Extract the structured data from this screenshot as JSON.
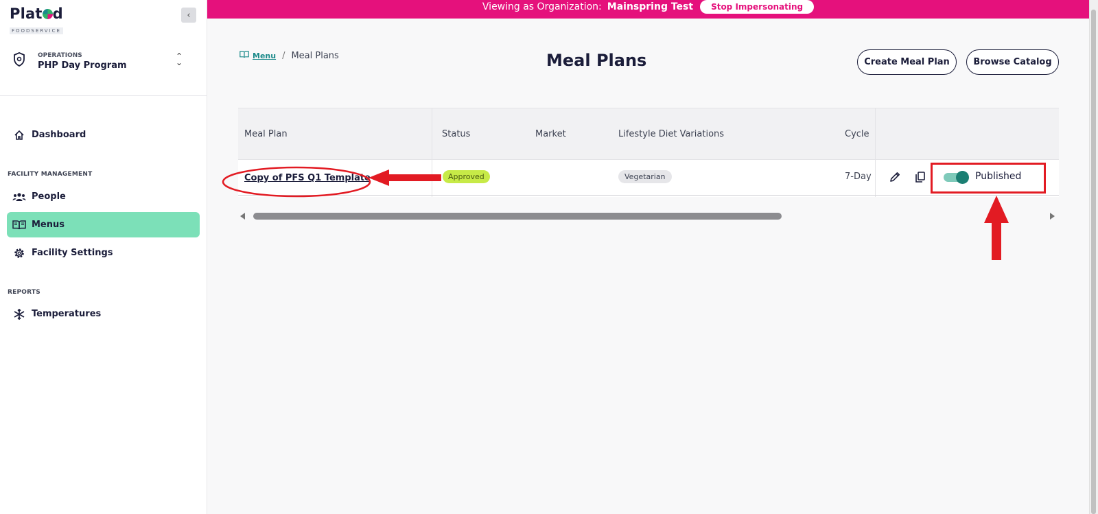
{
  "banner": {
    "viewing_text": "Viewing as Organization:",
    "organization": "Mainspring Test",
    "stop_button": "Stop Impersonating"
  },
  "logo": {
    "word_start": "Plat",
    "word_end": "d",
    "sub": "FOODSERVICE"
  },
  "org_switcher": {
    "label": "OPERATIONS",
    "name": "PHP Day Program"
  },
  "sidebar": {
    "dashboard": "Dashboard",
    "facility_section": "FACILITY MANAGEMENT",
    "people": "People",
    "menus": "Menus",
    "facility_settings": "Facility Settings",
    "reports_section": "REPORTS",
    "temperatures": "Temperatures"
  },
  "breadcrumb": {
    "link": "Menu",
    "separator": "/",
    "current": "Meal Plans"
  },
  "page": {
    "title": "Meal Plans",
    "create_button": "Create Meal Plan",
    "browse_button": "Browse Catalog"
  },
  "table": {
    "headers": {
      "meal_plan": "Meal Plan",
      "status": "Status",
      "market": "Market",
      "lifestyle": "Lifestyle Diet Variations",
      "cycle": "Cycle"
    },
    "rows": [
      {
        "meal_plan": "Copy of PFS Q1 Template",
        "status": "Approved",
        "market": "",
        "lifestyle": "Vegetarian",
        "cycle": "7-Day",
        "published_label": "Published",
        "published": true
      }
    ]
  },
  "colors": {
    "banner": "#e5117c",
    "active_nav": "#7ce0b8",
    "status_approved": "#c7ea47",
    "toggle_on": "#1b7f73",
    "annotation": "#e21b23"
  }
}
